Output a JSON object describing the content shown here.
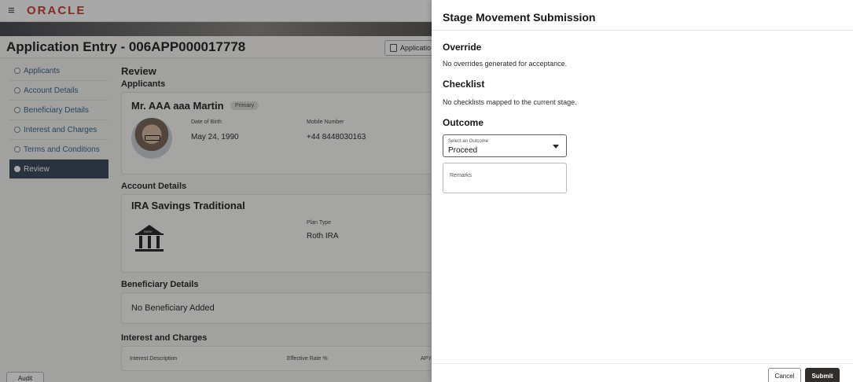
{
  "header": {
    "logo": "ORACLE",
    "menu_icon": "hamburger-icon"
  },
  "application": {
    "title": "Application Entry - 006APP000017778",
    "info_button": "Applicatio"
  },
  "sidebar": {
    "items": [
      {
        "label": "Applicants",
        "state": "done"
      },
      {
        "label": "Account Details",
        "state": "done"
      },
      {
        "label": "Beneficiary Details",
        "state": "pending"
      },
      {
        "label": "Interest and Charges",
        "state": "pending"
      },
      {
        "label": "Terms and Conditions",
        "state": "done"
      },
      {
        "label": "Review",
        "state": "active"
      }
    ]
  },
  "review": {
    "heading": "Review",
    "applicants_heading": "Applicants",
    "applicant": {
      "name": "Mr. AAA aaa Martin",
      "badge": "Primary",
      "dob_label": "Date of Birth",
      "dob_value": "May 24, 1990",
      "mobile_label": "Mobile Number",
      "mobile_value": "+44 8448030163"
    },
    "account_heading": "Account Details",
    "account": {
      "name": "IRA Savings Traditional",
      "plan_label": "Plan Type",
      "plan_value": "Roth IRA",
      "bank_sign": "BANK"
    },
    "beneficiary_heading": "Beneficiary Details",
    "beneficiary_empty": "No Beneficiary Added",
    "interest_heading": "Interest and Charges",
    "interest_columns": [
      "Interest Description",
      "Effective Rate %",
      "APY"
    ]
  },
  "audit_button": "Audit",
  "drawer": {
    "title": "Stage Movement Submission",
    "override_heading": "Override",
    "override_text": "No overrides generated for acceptance.",
    "checklist_heading": "Checklist",
    "checklist_text": "No checklists mapped to the current stage.",
    "outcome_heading": "Outcome",
    "outcome_label": "Select an Outcome",
    "outcome_value": "Proceed",
    "remarks_placeholder": "Remarks",
    "cancel_label": "Cancel",
    "submit_label": "Submit"
  },
  "colors": {
    "brand": "#c74634",
    "active_nav": "#3f4e62",
    "submit_bg": "#312d2a"
  }
}
